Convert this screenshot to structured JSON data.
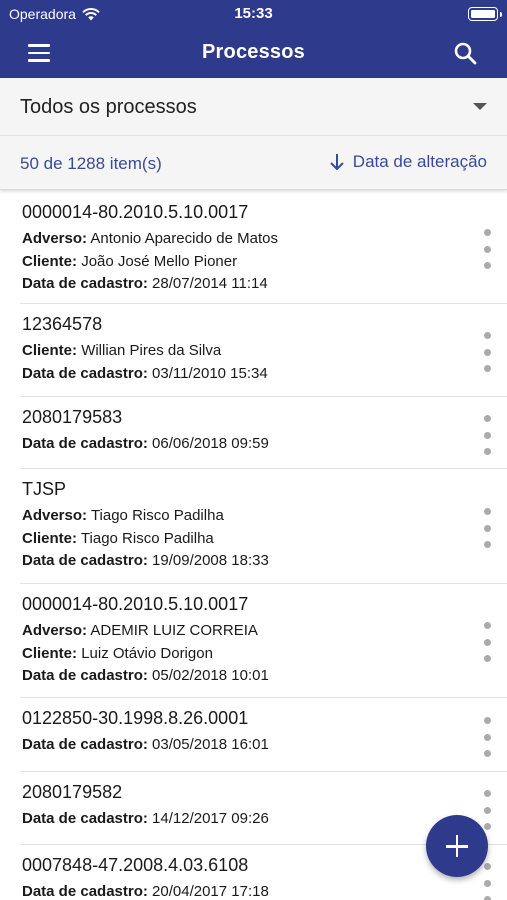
{
  "status_bar": {
    "carrier": "Operadora",
    "time": "15:33"
  },
  "app_bar": {
    "title": "Processos"
  },
  "filter": {
    "selected": "Todos os processos"
  },
  "sort_bar": {
    "count": "50 de 1288 item(s)",
    "sort_label": "Data de alteração"
  },
  "labels": {
    "adverso": "Adverso:",
    "cliente": "Cliente:",
    "data_cadastro": "Data de cadastro:"
  },
  "items": [
    {
      "number": "0000014-80.2010.5.10.0017",
      "adverso": "Antonio Aparecido de Matos",
      "cliente": "João José Mello Pioner",
      "data": "28/07/2014 11:14"
    },
    {
      "number": "12364578",
      "cliente": "Willian Pires da Silva",
      "data": "03/11/2010 15:34"
    },
    {
      "number": "2080179583",
      "data": "06/06/2018 09:59"
    },
    {
      "number": "TJSP",
      "adverso": "Tiago Risco Padilha",
      "cliente": "Tiago Risco Padilha",
      "data": "19/09/2008 18:33"
    },
    {
      "number": "0000014-80.2010.5.10.0017",
      "adverso": "ADEMIR LUIZ CORREIA",
      "cliente": "Luiz Otávio Dorigon",
      "data": "05/02/2018 10:01"
    },
    {
      "number": "0122850-30.1998.8.26.0001",
      "data": "03/05/2018 16:01"
    },
    {
      "number": "2080179582",
      "data": "14/12/2017 09:26"
    },
    {
      "number": "0007848-47.2008.4.03.6108",
      "data": "20/04/2017 17:18"
    }
  ]
}
